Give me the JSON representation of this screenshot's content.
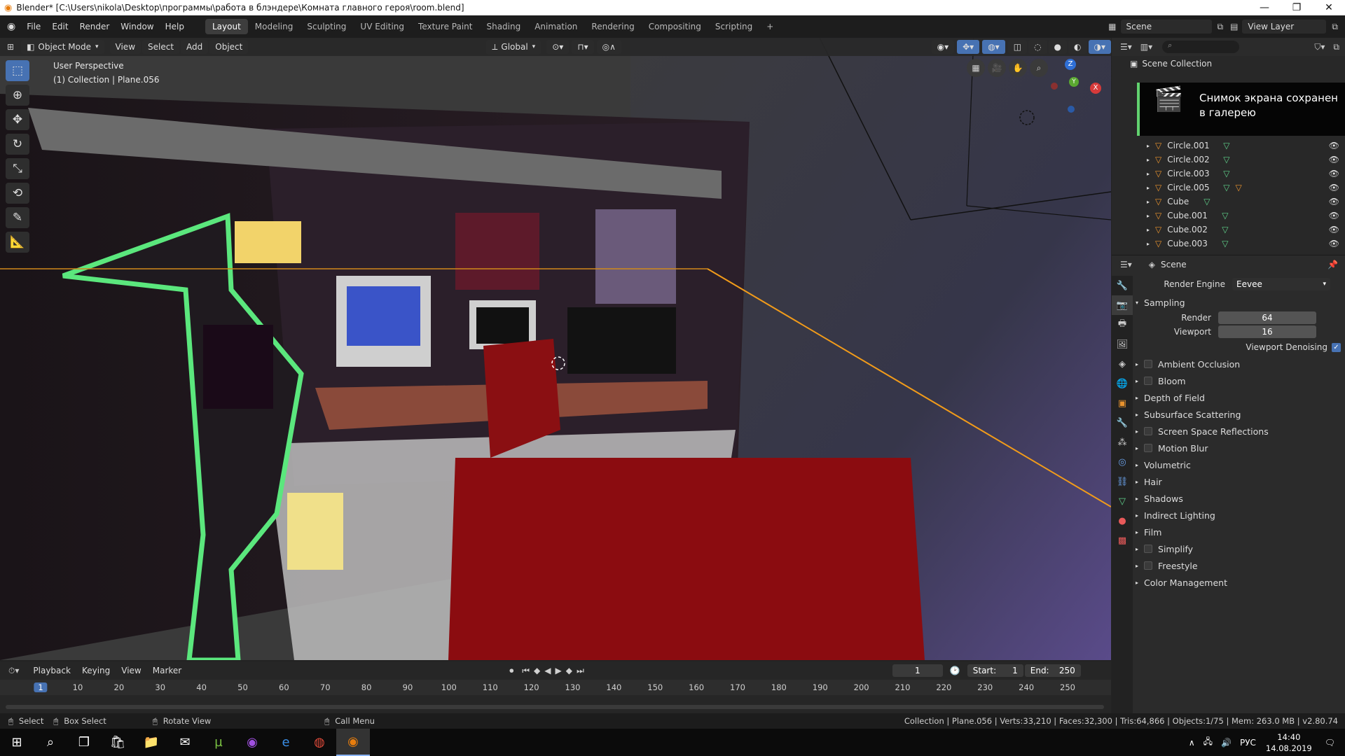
{
  "window": {
    "title": "Blender* [C:\\Users\\nikola\\Desktop\\программы\\работа в блэндере\\Комната главного героя\\room.blend]",
    "minimize": "—",
    "restore": "❐",
    "close": "✕"
  },
  "menu": {
    "items": [
      "File",
      "Edit",
      "Render",
      "Window",
      "Help"
    ]
  },
  "workspaces": {
    "tabs": [
      "Layout",
      "Modeling",
      "Sculpting",
      "UV Editing",
      "Texture Paint",
      "Shading",
      "Animation",
      "Rendering",
      "Compositing",
      "Scripting"
    ],
    "active": "Layout",
    "add": "+"
  },
  "topright": {
    "scene": "Scene",
    "view_layer": "View Layer"
  },
  "viewport_header": {
    "mode": "Object Mode",
    "menus": [
      "View",
      "Select",
      "Add",
      "Object"
    ],
    "orientation": "Global"
  },
  "viewport": {
    "perspective": "User Perspective",
    "collection": "(1) Collection | Plane.056"
  },
  "gizmo": {
    "z": "Z",
    "y": "Y",
    "x": "X"
  },
  "toast": {
    "line1": "Снимок экрана сохранен",
    "line2": "в галерею"
  },
  "outliner": {
    "title": "Scene Collection",
    "items": [
      {
        "name": "Circle.001"
      },
      {
        "name": "Circle.002"
      },
      {
        "name": "Circle.003"
      },
      {
        "name": "Circle.005"
      },
      {
        "name": "Cube"
      },
      {
        "name": "Cube.001"
      },
      {
        "name": "Cube.002"
      },
      {
        "name": "Cube.003"
      }
    ]
  },
  "properties": {
    "context": "Scene",
    "render_engine_label": "Render Engine",
    "render_engine": "Eevee",
    "sampling": "Sampling",
    "render_label": "Render",
    "render_value": "64",
    "viewport_label": "Viewport",
    "viewport_value": "16",
    "denoise_label": "Viewport Denoising",
    "panels": [
      {
        "label": "Ambient Occlusion",
        "checkbox": true
      },
      {
        "label": "Bloom",
        "checkbox": true
      },
      {
        "label": "Depth of Field",
        "checkbox": false
      },
      {
        "label": "Subsurface Scattering",
        "checkbox": false
      },
      {
        "label": "Screen Space Reflections",
        "checkbox": true
      },
      {
        "label": "Motion Blur",
        "checkbox": true
      },
      {
        "label": "Volumetric",
        "checkbox": false
      },
      {
        "label": "Hair",
        "checkbox": false
      },
      {
        "label": "Shadows",
        "checkbox": false
      },
      {
        "label": "Indirect Lighting",
        "checkbox": false
      },
      {
        "label": "Film",
        "checkbox": false
      },
      {
        "label": "Simplify",
        "checkbox": true
      },
      {
        "label": "Freestyle",
        "checkbox": true
      },
      {
        "label": "Color Management",
        "checkbox": false
      }
    ]
  },
  "timeline": {
    "menus": [
      "Playback",
      "Keying",
      "View",
      "Marker"
    ],
    "current_frame": "1",
    "start_label": "Start:",
    "start": "1",
    "end_label": "End:",
    "end": "250",
    "ticks": [
      "1",
      "10",
      "20",
      "30",
      "40",
      "50",
      "60",
      "70",
      "80",
      "90",
      "100",
      "110",
      "120",
      "130",
      "140",
      "150",
      "160",
      "170",
      "180",
      "190",
      "200",
      "210",
      "220",
      "230",
      "240",
      "250"
    ]
  },
  "statusbar": {
    "select": "Select",
    "box_select": "Box Select",
    "rotate": "Rotate View",
    "call_menu": "Call Menu",
    "stats": "Collection | Plane.056 | Verts:33,210 | Faces:32,300 | Tris:64,866 | Objects:1/75 | Mem: 263.0 MB | v2.80.74"
  },
  "taskbar": {
    "lang": "РУС",
    "time": "14:40",
    "date": "14.08.2019"
  }
}
